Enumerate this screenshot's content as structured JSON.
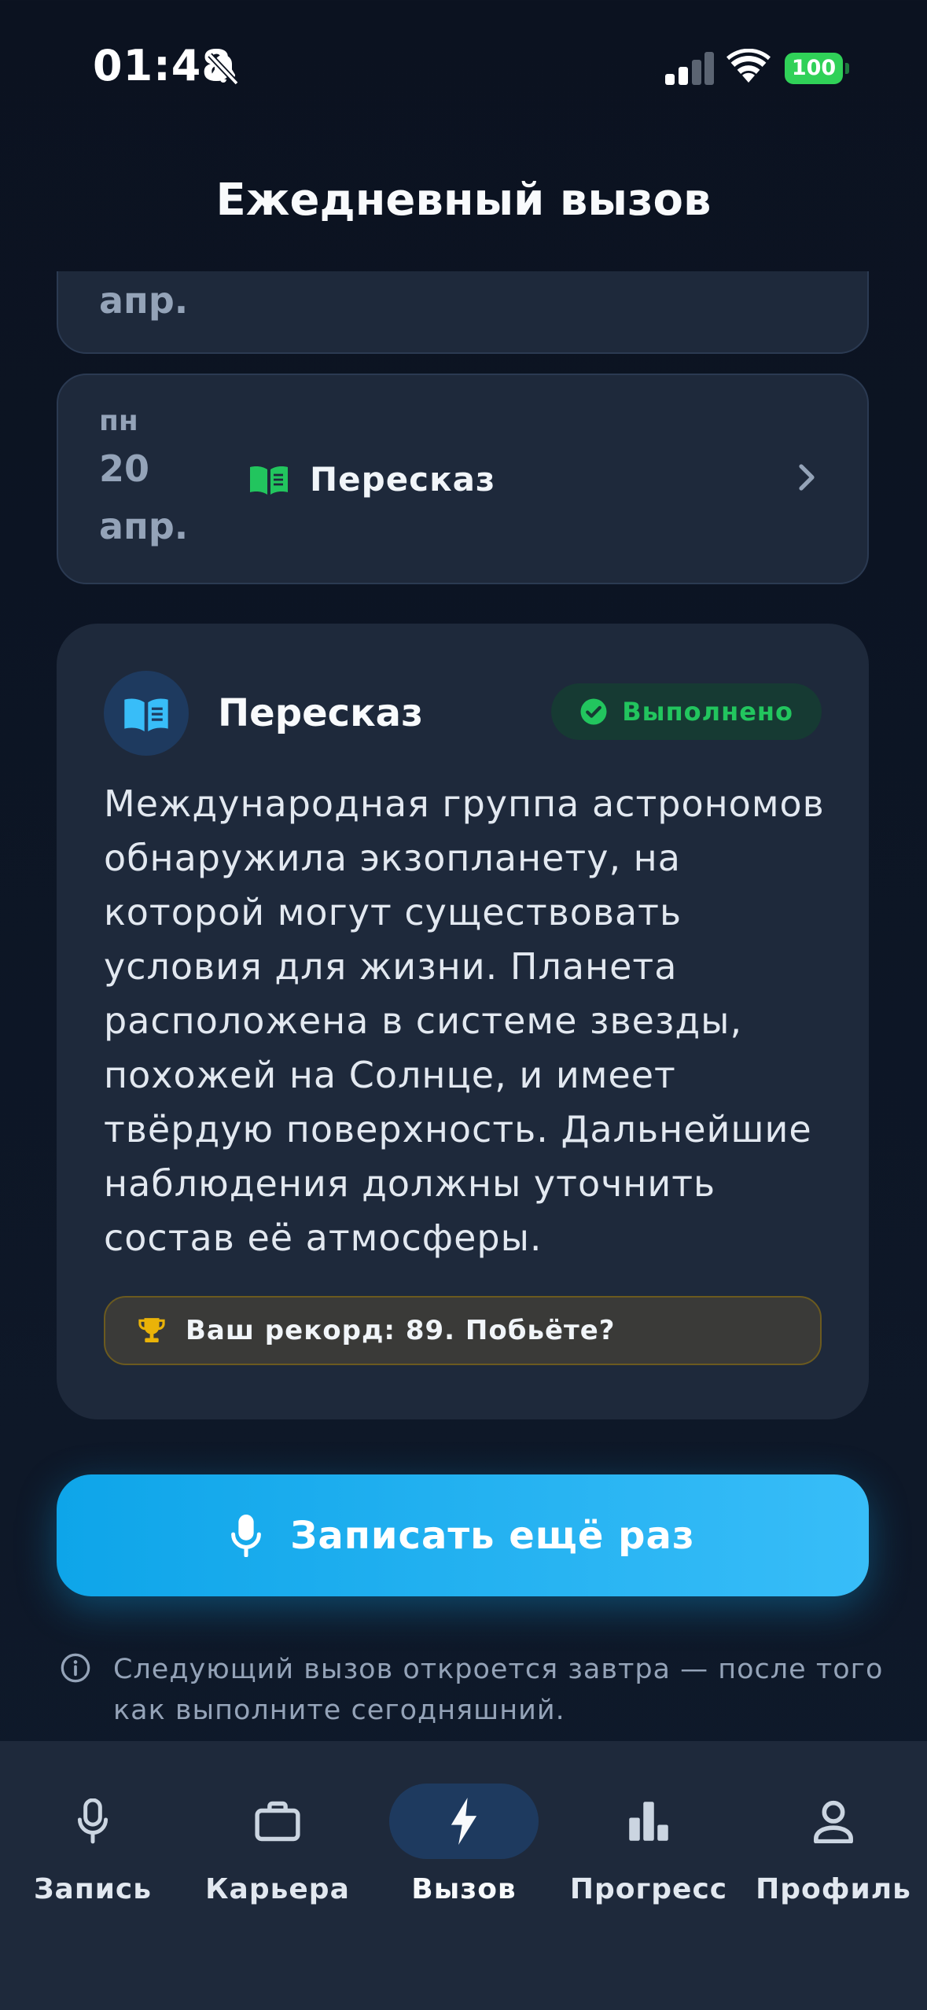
{
  "status_bar": {
    "time": "01:48",
    "battery": "100"
  },
  "header": {
    "title": "Ежедневный вызов"
  },
  "days": [
    {
      "dow": "",
      "day": "",
      "month": "апр."
    },
    {
      "dow": "пн",
      "day": "20",
      "month": "апр.",
      "task": "Пересказ"
    }
  ],
  "challenge": {
    "title": "Пересказ",
    "status": "Выполнено",
    "text": "Международная группа астрономов обнаружила экзопланету, на которой могут существовать условия для жизни. Планета расположена в системе звезды, похожей на Солнце, и имеет твёрдую поверхность. Дальнейшие наблюдения должны уточнить состав её атмосферы.",
    "record": "Ваш рекорд: 89. Побьёте?"
  },
  "record_button": {
    "label": "Записать ещё раз"
  },
  "info": {
    "text": "Следующий вызов откроется завтра — после того как выполните сегодняшний."
  },
  "tabs": [
    {
      "label": "Запись",
      "icon": "mic-icon"
    },
    {
      "label": "Карьера",
      "icon": "briefcase-icon"
    },
    {
      "label": "Вызов",
      "icon": "bolt-icon",
      "active": true
    },
    {
      "label": "Прогресс",
      "icon": "bar-chart-icon"
    },
    {
      "label": "Профиль",
      "icon": "person-icon"
    }
  ],
  "colors": {
    "accent": "#0ea5e9",
    "success": "#22c55e",
    "gold": "#eab308",
    "background": "#0f172a",
    "card": "#1e293b"
  }
}
